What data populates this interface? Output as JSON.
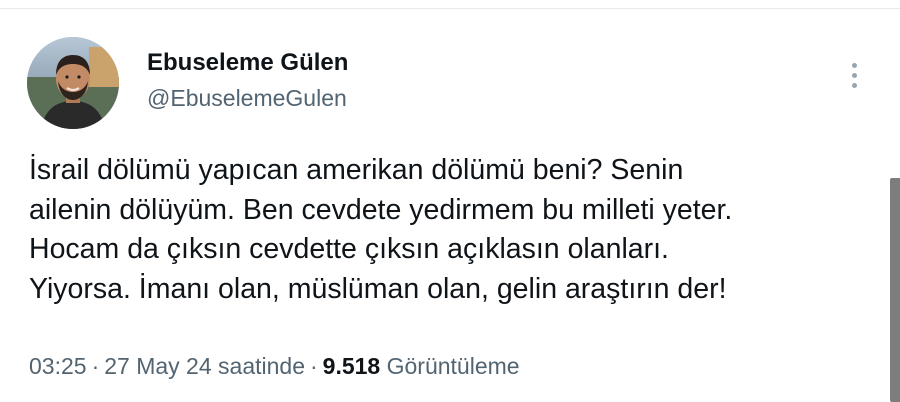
{
  "tweet": {
    "author": {
      "display_name": "Ebuseleme Gülen",
      "handle": "@EbuselemeGulen",
      "avatar_icon": "profile-photo"
    },
    "text_lines": [
      "İsrail dölümü yapıcan amerikan dölümü beni? Senin",
      "ailenin dölüyüm. Ben cevdete yedirmem bu milleti yeter.",
      "Hocam da çıksın cevdette çıksın açıklasın olanları.",
      "Yiyorsa. İmanı olan, müslüman olan, gelin araştırın der!"
    ],
    "time": "03:25",
    "separator": "·",
    "date": "27 May 24 saatinde",
    "views_count": "9.518",
    "views_label": "Görüntüleme",
    "more_icon": "more-vertical-icon"
  },
  "colors": {
    "text_primary": "#0f1419",
    "text_secondary": "#536471",
    "divider": "#e7e9ea",
    "scrollbar": "#7d7d7d"
  }
}
